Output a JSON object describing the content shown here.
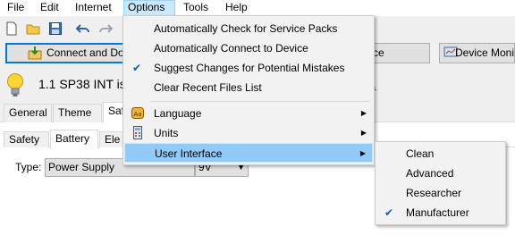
{
  "menubar": {
    "items": [
      "File",
      "Edit",
      "Internet",
      "Options",
      "Tools",
      "Help"
    ]
  },
  "buttons": {
    "connect": "Connect and Dov",
    "middle": "ce",
    "device_monitor": "Device Monit"
  },
  "info": {
    "text": "1.1 SP38 INT is",
    "link": "e."
  },
  "tabs_main": [
    "General",
    "Theme",
    "Saf"
  ],
  "tabs_sub": [
    "Safety",
    "Battery",
    "Ele"
  ],
  "type_field": {
    "label": "Type:",
    "value": "Power Supply",
    "voltage": "9V"
  },
  "options_menu": {
    "items": [
      "Automatically Check for Service Packs",
      "Automatically Connect to Device",
      "Suggest Changes for Potential Mistakes",
      "Clear Recent Files List",
      "Language",
      "Units",
      "User Interface"
    ]
  },
  "ui_submenu": {
    "items": [
      "Clean",
      "Advanced",
      "Researcher",
      "Manufacturer"
    ]
  },
  "colors": {
    "menu_highlight": "#91c9f7",
    "menubar_open": "#cce8ff",
    "check": "#0a60b8"
  }
}
